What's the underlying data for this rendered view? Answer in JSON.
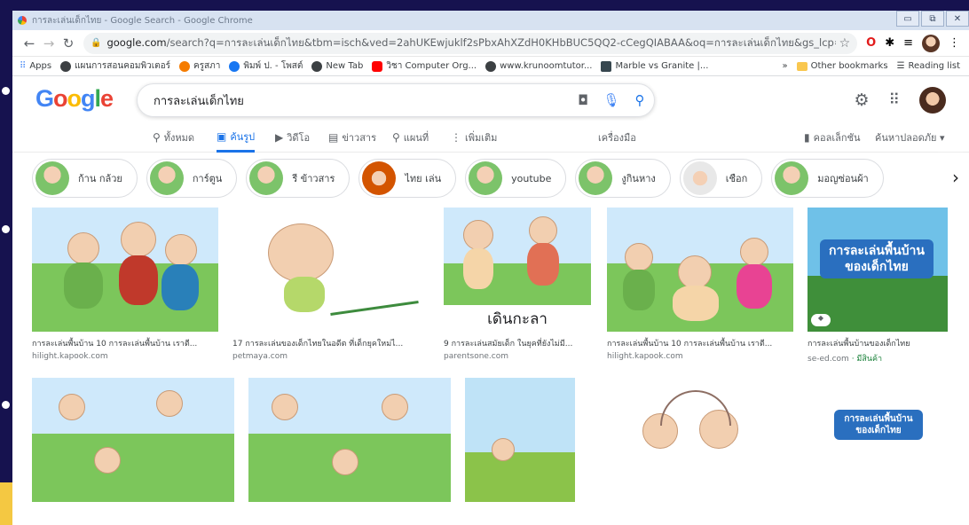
{
  "window": {
    "title": "การละเล่นเด็กไทย - Google Search - Google Chrome",
    "controls": [
      "▭",
      "⧉",
      "✕"
    ]
  },
  "nav": {
    "url_domain": "google.com",
    "url_rest": "/search?q=การละเล่นเด็กไทย&tbm=isch&ved=2ahUKEwjuklf2sPbxAhXZdH0KHbBUC5QQ2-cCegQIABAA&oq=การละเล่นเด็กไทย&gs_lcp=CgN..."
  },
  "bookmarks": {
    "items": [
      "Apps",
      "แผนการสอนคอมพิวเตอร์",
      "ครูสภา",
      "พิมพ์ ป. - โพสต์",
      "New Tab",
      "วิชา Computer Org...",
      "www.krunoomtutor...",
      "Marble vs Granite |..."
    ],
    "overflow": "»",
    "other": "Other bookmarks",
    "reading": "Reading list"
  },
  "google": {
    "logo": [
      "G",
      "o",
      "o",
      "g",
      "l",
      "e"
    ],
    "query": "การละเล่นเด็กไทย"
  },
  "tabs": {
    "all": "ทั้งหมด",
    "images": "ค้นรูป",
    "videos": "วิดีโอ",
    "news": "ข่าวสาร",
    "maps": "แผนที่",
    "more": "เพิ่มเติม",
    "tools": "เครื่องมือ",
    "collections": "คอลเล็กชัน",
    "safesearch": "ค้นหาปลอดภัย ▾"
  },
  "chips": [
    "ก้าน กล้วย",
    "การ์ตูน",
    "รี ข้าวสาร",
    "ไทย เล่น",
    "youtube",
    "งูกินหาง",
    "เชือก",
    "มอญซ่อนผ้า"
  ],
  "results": [
    {
      "caption": "การละเล่นพื้นบ้าน 10 การละเล่นพื้นบ้าน เราตี...",
      "source": "hilight.kapook.com"
    },
    {
      "caption": "17 การละเล่นของเด็กไทยในอดีต ที่เด็กยุคใหม่ไ...",
      "source": "petmaya.com"
    },
    {
      "caption": "9 การละเล่นสมัยเด็ก ในยุคที่ยังไม่มี...",
      "source": "parentsone.com",
      "overlay": "เดินกะลา"
    },
    {
      "caption": "การละเล่นพื้นบ้าน 10 การละเล่นพื้นบ้าน เราตี...",
      "source": "hilight.kapook.com"
    },
    {
      "caption": "การละเล่นพื้นบ้านของเด็กไทย",
      "source": "se-ed.com",
      "shop": "· มีสินค้า",
      "poster": "การละเล่นพื้นบ้าน ของเด็กไทย"
    }
  ],
  "second_row_poster": "การละเล่นพื้นบ้าน ของเด็กไทย",
  "colors": {
    "slide_bg": "#16124f",
    "titlebar": "#d7e2f1",
    "google_blue": "#4285f4",
    "accent": "#f4c842"
  }
}
